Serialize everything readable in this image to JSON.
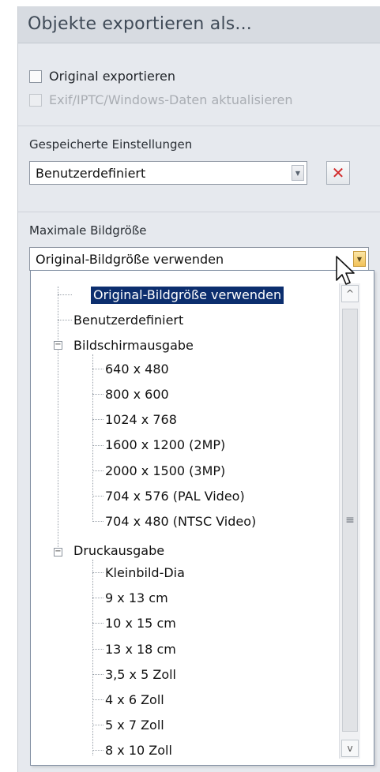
{
  "panel": {
    "title": "Objekte exportieren als..."
  },
  "export_options": {
    "original_label": "Original exportieren",
    "original_checked": false,
    "exif_label": "Exif/IPTC/Windows-Daten aktualisieren",
    "exif_checked": false,
    "exif_disabled": true
  },
  "saved_settings": {
    "label": "Gespeicherte Einstellungen",
    "value": "Benutzerdefiniert",
    "delete_icon": "close-x-icon"
  },
  "max_size": {
    "label": "Maximale Bildgröße",
    "value": "Original-Bildgröße verwenden",
    "options": {
      "original": "Original-Bildgröße verwenden",
      "custom": "Benutzerdefiniert",
      "screen_group": "Bildschirmausgabe",
      "screen": [
        "640 x 480",
        "800 x 600",
        "1024 x 768",
        "1600 x 1200 (2MP)",
        "2000 x 1500 (3MP)",
        "704 x 576 (PAL Video)",
        "704 x 480 (NTSC Video)"
      ],
      "print_group": "Druckausgabe",
      "print": [
        "Kleinbild-Dia",
        "9 x 13 cm",
        "10 x 15 cm",
        "13 x 18 cm",
        "3,5 x 5 Zoll",
        "4 x 6 Zoll",
        "5 x 7 Zoll",
        "8 x 10 Zoll"
      ]
    }
  },
  "icons": {
    "expander_minus": "−",
    "scroll_up": "^",
    "scroll_down": "v",
    "scroll_grip": "≡",
    "combo_arrow": "▼"
  },
  "colors": {
    "selection": "#0c2e6e",
    "delete": "#d22a2a",
    "active_arrow": "#f2c259"
  }
}
